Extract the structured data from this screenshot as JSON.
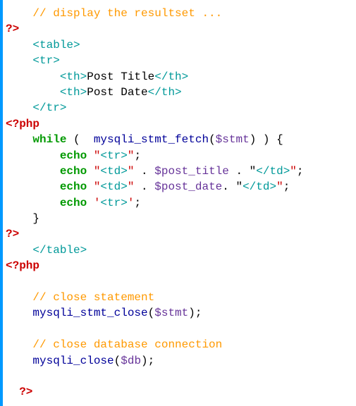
{
  "code": {
    "l1_comment": "// display the resultset ...",
    "l2_phpclose": "?>",
    "l3_tag": "<table>",
    "l4_tag": "<tr>",
    "l5_open": "<th>",
    "l5_text": "Post Title",
    "l5_close": "</th>",
    "l6_open": "<th>",
    "l6_text": "Post Date",
    "l6_close": "</th>",
    "l7_tag": "</tr>",
    "l8_phpopen": "<?php",
    "l9_while": "while",
    "l9_paren_open": " (  ",
    "l9_func": "mysqli_stmt_fetch",
    "l9_paren_inner_open": "(",
    "l9_var": "$stmt",
    "l9_paren_inner_close": ")",
    "l9_paren_close": " ) {",
    "l10_echo": "echo",
    "l10_q1": " \"",
    "l10_tag": "<tr>",
    "l10_q2": "\"",
    "l10_semi": ";",
    "l11_echo": "echo",
    "l11_q1": " \"",
    "l11_tag": "<td>",
    "l11_q2": "\"",
    "l11_concat1": " . ",
    "l11_var": "$post_title",
    "l11_concat2": " . \"",
    "l11_tag2": "</td>",
    "l11_q3": "\"",
    "l11_semi": ";",
    "l12_echo": "echo",
    "l12_q1": " \"",
    "l12_tag": "<td>",
    "l12_q2": "\"",
    "l12_concat1": " . ",
    "l12_var": "$post_date",
    "l12_concat2": ". \"",
    "l12_tag2": "</td>",
    "l12_q3": "\"",
    "l12_semi": ";",
    "l13_echo": "echo",
    "l13_q1": " '",
    "l13_tag": "<tr>",
    "l13_q2": "'",
    "l13_semi": ";",
    "l14_brace": "}",
    "l15_phpclose": "?>",
    "l16_tag": "</table>",
    "l17_phpopen": "<?php",
    "l18_comment": "// close statement",
    "l19_func": "mysqli_stmt_close",
    "l19_open": "(",
    "l19_var": "$stmt",
    "l19_close": ")",
    "l19_semi": ";",
    "l20_comment": "// close database connection",
    "l21_func": "mysqli_close",
    "l21_open": "(",
    "l21_var": "$db",
    "l21_close": ")",
    "l21_semi": ";",
    "l22_phpclose": "?>"
  }
}
